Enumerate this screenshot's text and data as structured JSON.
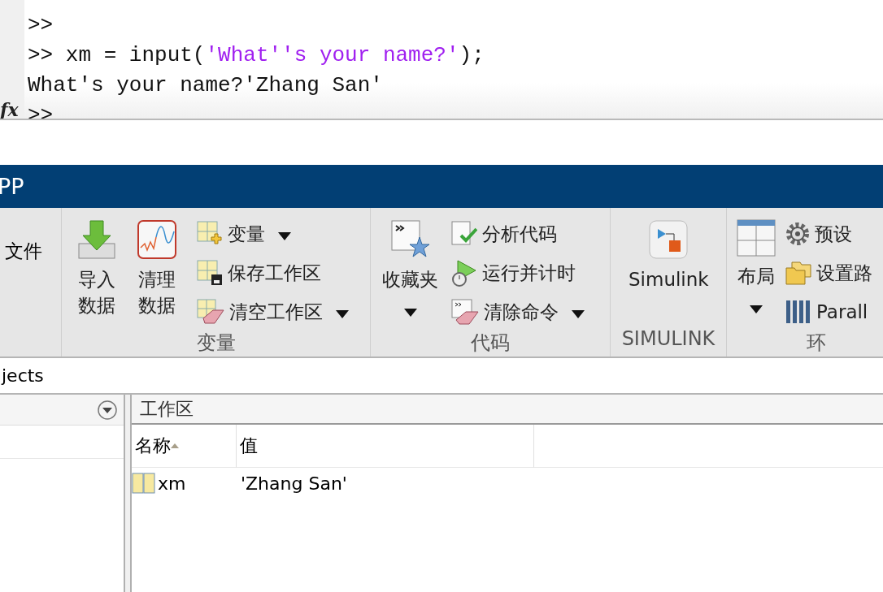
{
  "command_window": {
    "fx": "fx",
    "lines": [
      {
        "kind": "prompt",
        "text": ">>"
      },
      {
        "kind": "code",
        "prompt": ">>",
        "parts": [
          {
            "kind": "plain",
            "text": "xm = input("
          },
          {
            "kind": "string",
            "text": "'What''s your name?'"
          },
          {
            "kind": "plain",
            "text": ");"
          }
        ]
      },
      {
        "kind": "output",
        "text": "What's your name?'Zhang San'"
      },
      {
        "kind": "prompt",
        "text": ">>"
      }
    ]
  },
  "title_bar": {
    "title": "PP"
  },
  "ribbon": {
    "sections": [
      {
        "items": [
          {
            "kind": "text_column",
            "texts": [
              "文件"
            ]
          }
        ]
      },
      {
        "label": "变量",
        "items": [
          {
            "kind": "large",
            "lines": [
              "导入",
              "数据"
            ],
            "dropdown": false
          },
          {
            "kind": "large",
            "lines": [
              "清理",
              "数据"
            ],
            "dropdown": false
          },
          {
            "kind": "column",
            "entries": [
              {
                "label": "变量",
                "dropdown": true
              },
              {
                "label": "保存工作区",
                "dropdown": false
              },
              {
                "label": "清空工作区",
                "dropdown": true
              }
            ]
          }
        ]
      },
      {
        "label": "代码",
        "items": [
          {
            "kind": "large",
            "lines": [
              "收藏夹"
            ],
            "dropdown": true
          },
          {
            "kind": "column",
            "entries": [
              {
                "label": "分析代码",
                "dropdown": false
              },
              {
                "label": "运行并计时",
                "dropdown": false
              },
              {
                "label": "清除命令",
                "dropdown": true
              }
            ]
          }
        ]
      },
      {
        "label": "SIMULINK",
        "items": [
          {
            "kind": "large",
            "lines": [
              "Simulink"
            ],
            "dropdown": false
          }
        ]
      },
      {
        "label": "环",
        "items": [
          {
            "kind": "large",
            "lines": [
              "布局"
            ],
            "dropdown": true
          },
          {
            "kind": "column",
            "entries": [
              {
                "label": "预设",
                "dropdown": false
              },
              {
                "label": "设置路",
                "dropdown": false
              },
              {
                "label": "Parall",
                "dropdown": false
              }
            ]
          }
        ]
      }
    ]
  },
  "address_bar": {
    "text": "jects"
  },
  "workspace": {
    "title": "工作区",
    "columns": [
      {
        "label": "名称",
        "sorted": true
      },
      {
        "label": "值",
        "sorted": false
      }
    ],
    "rows": [
      {
        "name": "xm",
        "value": "'Zhang San'"
      }
    ]
  }
}
